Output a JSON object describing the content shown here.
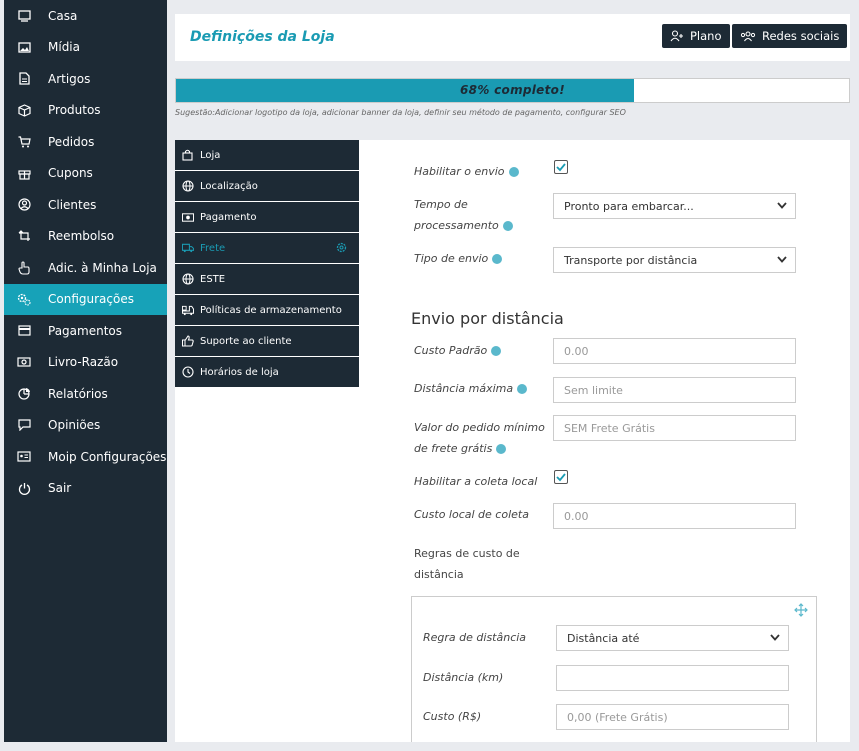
{
  "sidebar": {
    "items": [
      {
        "label": "Casa",
        "icon": "monitor-icon"
      },
      {
        "label": "Mídia",
        "icon": "image-icon"
      },
      {
        "label": "Artigos",
        "icon": "document-icon"
      },
      {
        "label": "Produtos",
        "icon": "box-icon"
      },
      {
        "label": "Pedidos",
        "icon": "cart-icon"
      },
      {
        "label": "Cupons",
        "icon": "gift-icon"
      },
      {
        "label": "Clientes",
        "icon": "user-circle-icon"
      },
      {
        "label": "Reembolso",
        "icon": "refund-icon"
      },
      {
        "label": "Adic. à Minha Loja",
        "icon": "hand-pointer-icon"
      },
      {
        "label": "Configurações",
        "icon": "gears-icon"
      },
      {
        "label": "Pagamentos",
        "icon": "credit-card-icon"
      },
      {
        "label": "Livro-Razão",
        "icon": "money-icon"
      },
      {
        "label": "Relatórios",
        "icon": "pie-chart-icon"
      },
      {
        "label": "Opiniões",
        "icon": "comment-icon"
      },
      {
        "label": "Moip Configurações",
        "icon": "id-card-icon"
      },
      {
        "label": "Sair",
        "icon": "power-icon"
      }
    ],
    "active": "Configurações",
    "active_color": "#17a2b8"
  },
  "header": {
    "title": "Definições da Loja",
    "plan_label": "Plano",
    "social_label": "Redes sociais"
  },
  "progress": {
    "percent": 68,
    "label": "68% completo!",
    "suggestion": "Sugestão:Adicionar logotipo da loja, adicionar banner da loja, definir seu método de pagamento, configurar SEO"
  },
  "submenu": {
    "items": [
      {
        "label": "Loja",
        "icon": "bag-icon"
      },
      {
        "label": "Localização",
        "icon": "globe-icon"
      },
      {
        "label": "Pagamento",
        "icon": "money-icon"
      },
      {
        "label": "Frete",
        "icon": "truck-icon"
      },
      {
        "label": "ESTE",
        "icon": "globe-icon"
      },
      {
        "label": "Políticas de armazenamento",
        "icon": "truck-loading-icon"
      },
      {
        "label": "Suporte ao cliente",
        "icon": "thumbs-up-icon"
      },
      {
        "label": "Horários de loja",
        "icon": "clock-icon"
      }
    ],
    "active": "Frete"
  },
  "form": {
    "enable_shipping_label": "Habilitar o envio",
    "enable_shipping_checked": true,
    "processing_time_label_1": "Tempo de",
    "processing_time_label_2": "processamento",
    "processing_time_value": "Pronto para embarcar...",
    "shipping_type_label": "Tipo de envio",
    "shipping_type_value": "Transporte por distância",
    "section_title": "Envio por distância",
    "default_cost_label": "Custo Padrão",
    "default_cost_placeholder": "0.00",
    "max_distance_label": "Distância máxima",
    "max_distance_placeholder": "Sem limite",
    "min_order_label_1": "Valor do pedido mínimo",
    "min_order_label_2": "de frete grátis",
    "min_order_placeholder": "SEM Frete Grátis",
    "local_pickup_label": "Habilitar a coleta local",
    "local_pickup_checked": true,
    "local_pickup_cost_label": "Custo local de coleta",
    "local_pickup_cost_placeholder": "0.00",
    "rules_label_1": "Regras de custo de",
    "rules_label_2": "distância",
    "rule": {
      "rule_label": "Regra de distância",
      "rule_value": "Distância até",
      "distance_label": "Distância (km)",
      "distance_value": "",
      "cost_label": "Custo (R$)",
      "cost_placeholder": "0,00 (Frete Grátis)"
    }
  },
  "colors": {
    "sidebar_bg": "#1d2a35",
    "accent": "#1a9bb3"
  }
}
